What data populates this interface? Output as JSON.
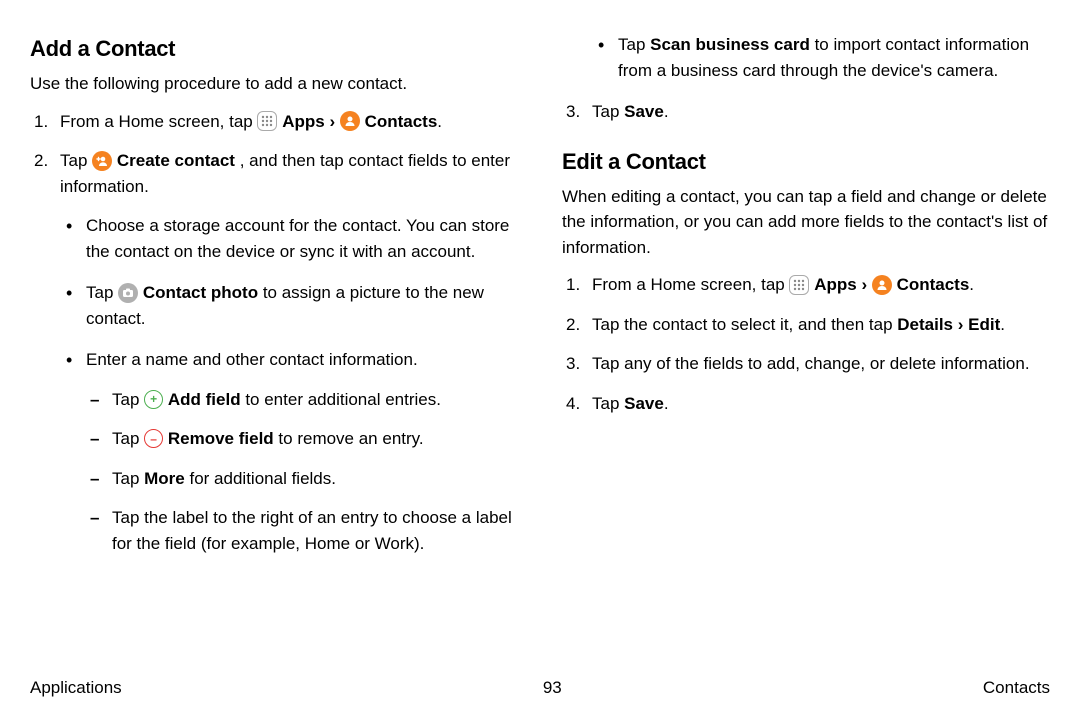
{
  "left": {
    "heading": "Add a Contact",
    "intro": "Use the following procedure to add a new contact.",
    "step1_a": "From a Home screen, tap ",
    "step1_apps": " Apps ",
    "step1_arrow": "› ",
    "step1_contacts": " Contacts",
    "step2_a": "Tap ",
    "step2_create": " Create contact",
    "step2_b": ", and then tap contact fields to enter information.",
    "b1": "Choose a storage account for the contact. You can store the contact on the device or sync it with an account.",
    "b2_a": "Tap ",
    "b2_photo": " Contact photo",
    "b2_b": " to assign a picture to the new contact.",
    "b3": "Enter a name and other contact information.",
    "d1_a": "Tap ",
    "d1_add": " Add field",
    "d1_b": " to enter additional entries.",
    "d2_a": "Tap ",
    "d2_remove": " Remove field",
    "d2_b": " to remove an entry.",
    "d3_a": "Tap ",
    "d3_more": "More",
    "d3_b": " for additional fields.",
    "d4": "Tap the label to the right of an entry to choose a label for the field (for example, Home or Work)."
  },
  "right": {
    "topbullet_a": "Tap ",
    "topbullet_scan": "Scan business card",
    "topbullet_b": " to import contact information from a business card through the device's camera.",
    "step3_a": "Tap ",
    "step3_save": "Save",
    "heading": "Edit a Contact",
    "intro": "When editing a contact, you can tap a field and change or delete the information, or you can add more fields to the contact's list of information.",
    "e1_a": "From a Home screen, tap ",
    "e1_apps": " Apps ",
    "e1_arrow": "› ",
    "e1_contacts": " Contacts",
    "e2_a": "Tap the contact to select it, and then tap ",
    "e2_details": "Details › Edit",
    "e3": "Tap any of the fields to add, change, or delete information.",
    "e4_a": "Tap ",
    "e4_save": "Save"
  },
  "footer": {
    "left": "Applications",
    "center": "93",
    "right": "Contacts"
  }
}
